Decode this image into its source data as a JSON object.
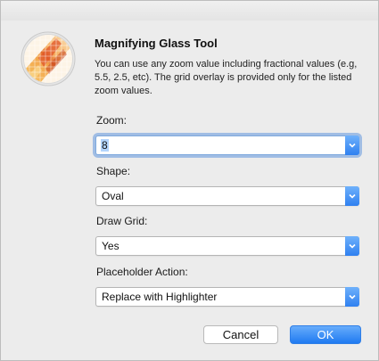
{
  "dialog": {
    "title": "Magnifying Glass Tool",
    "description": "You can use any zoom value including fractional values (e.g, 5.5, 2.5, etc). The grid overlay is provided only for the listed zoom values.",
    "icon": "magnifying-glass-grid-icon"
  },
  "fields": {
    "zoom": {
      "label": "Zoom:",
      "value": "8"
    },
    "shape": {
      "label": "Shape:",
      "value": "Oval"
    },
    "draw_grid": {
      "label": "Draw Grid:",
      "value": "Yes"
    },
    "placeholder_action": {
      "label": "Placeholder Action:",
      "value": "Replace with Highlighter"
    }
  },
  "buttons": {
    "cancel": "Cancel",
    "ok": "OK"
  },
  "colors": {
    "accent": "#2f80f0",
    "focus_ring": "#6297de",
    "background": "#ececec"
  }
}
